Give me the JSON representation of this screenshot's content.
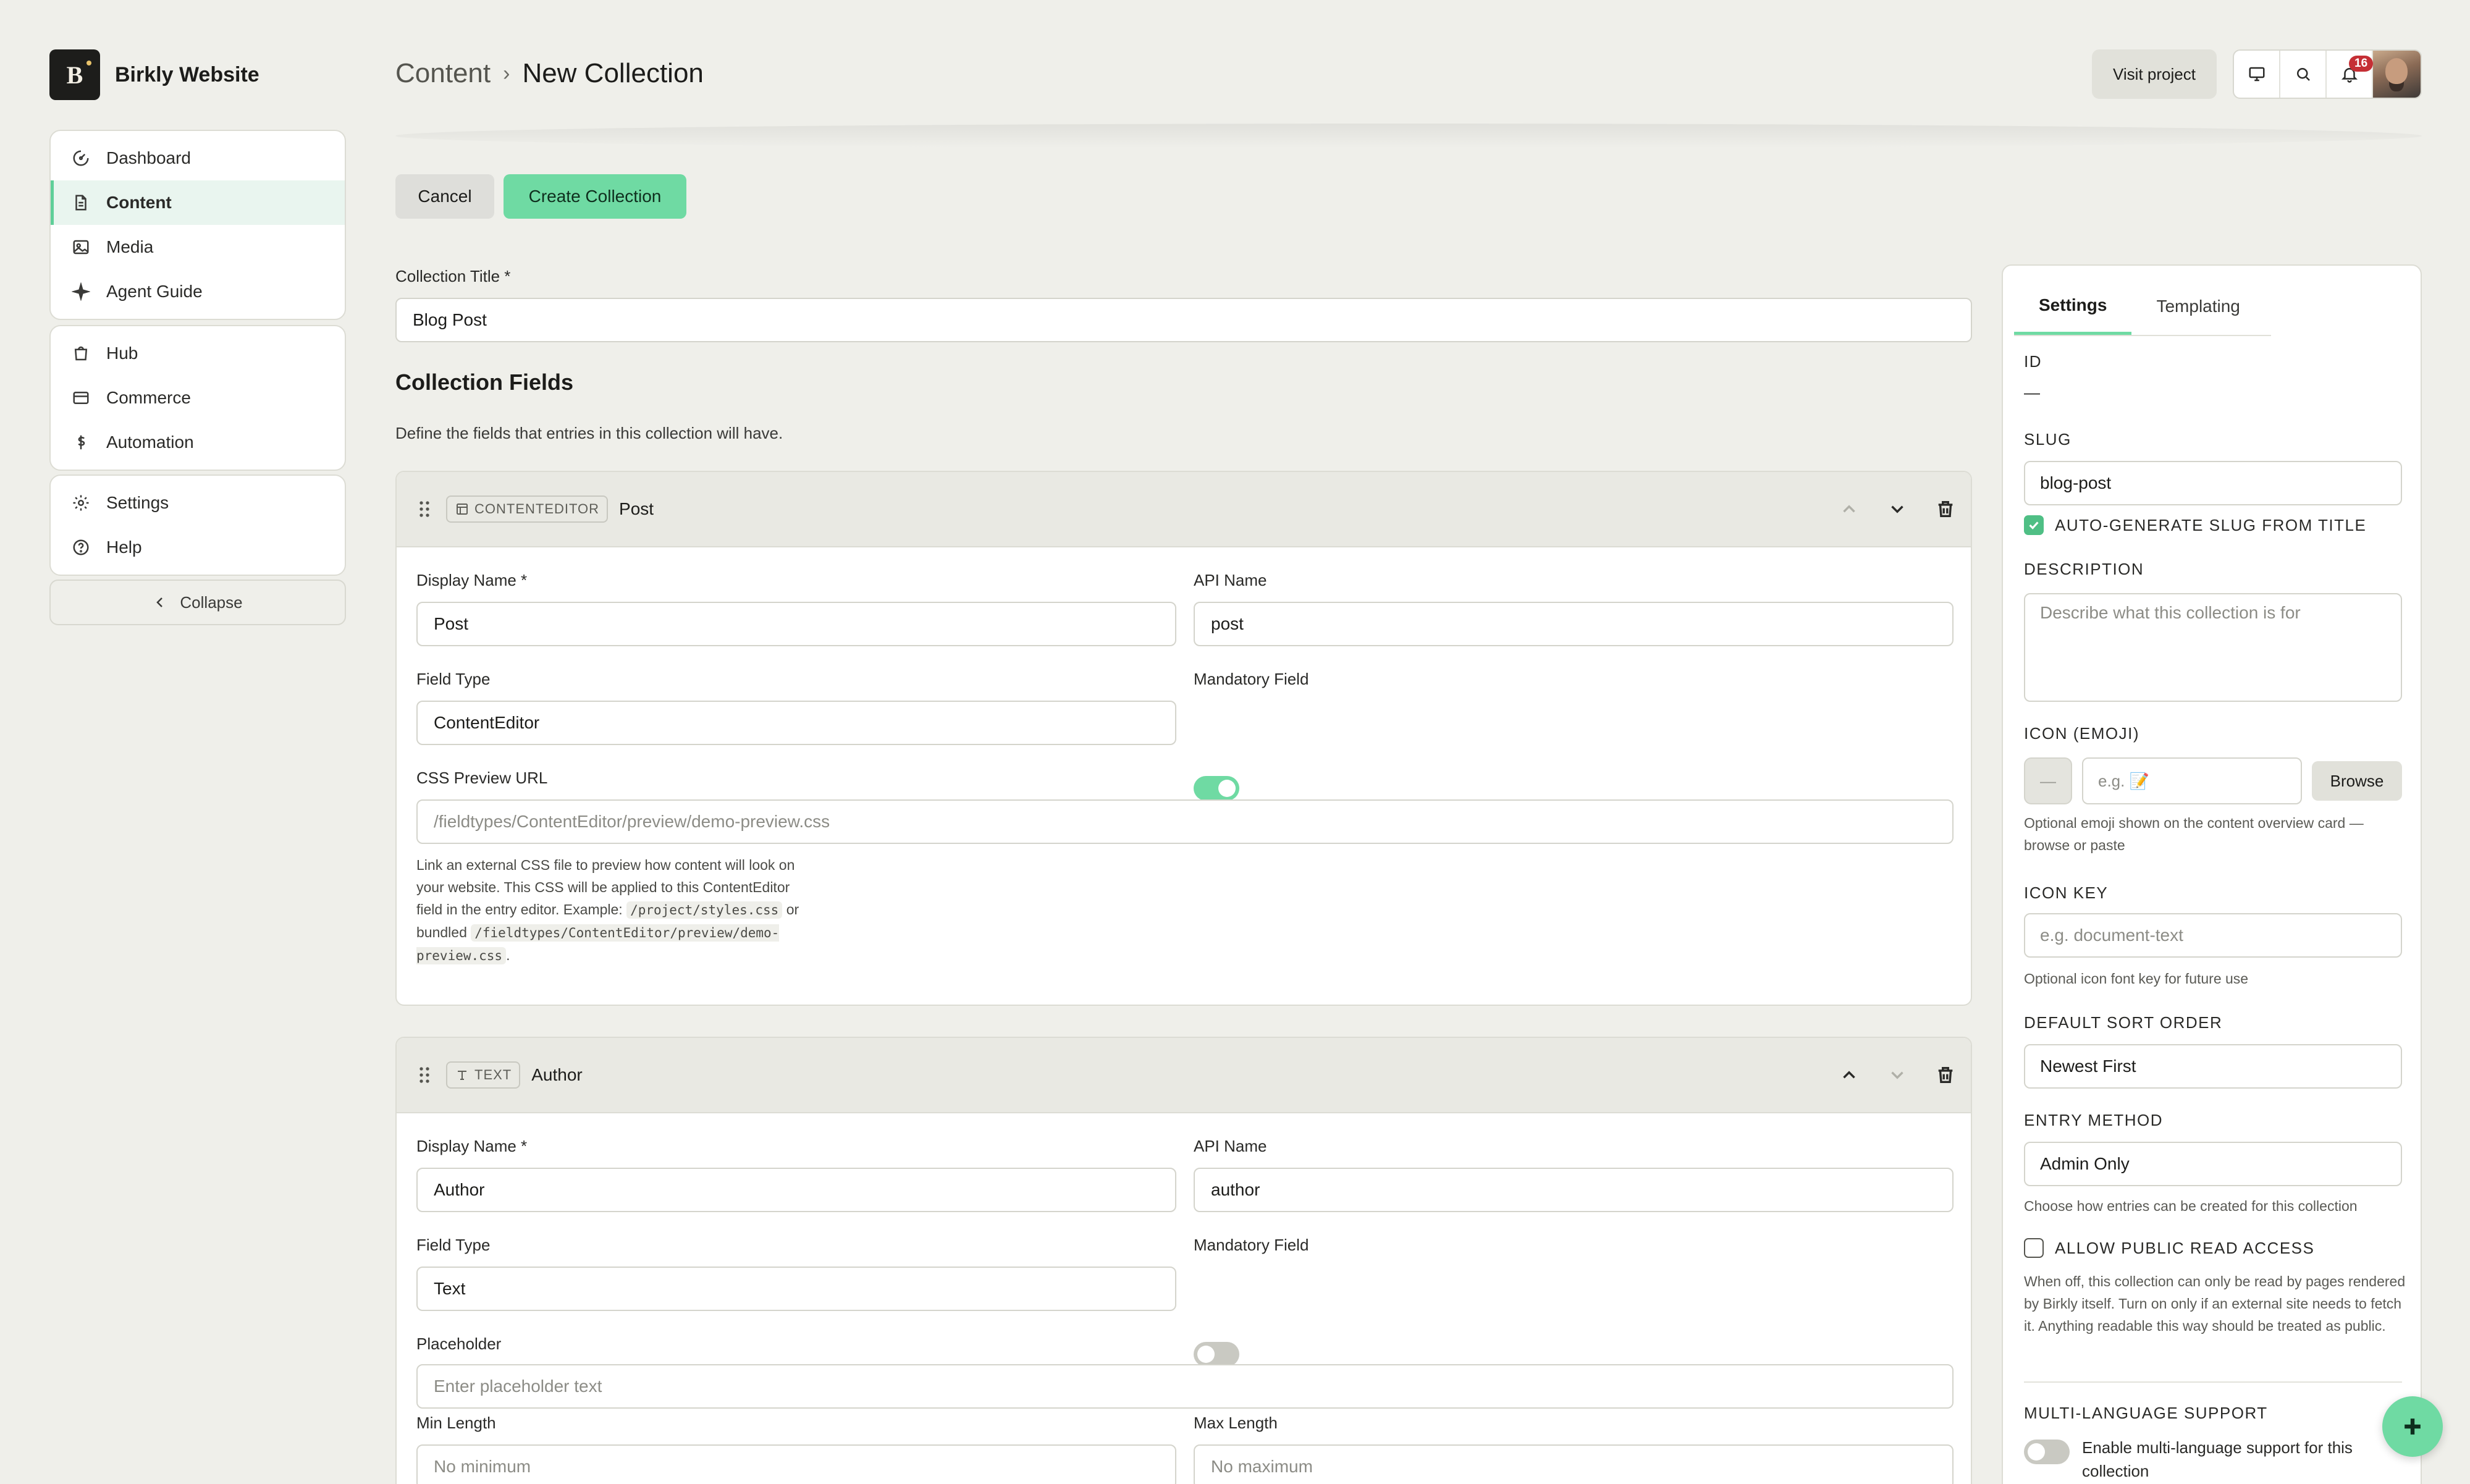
{
  "brand": {
    "logo": "B",
    "name": "Birkly Website"
  },
  "nav": {
    "group1": [
      {
        "label": "Dashboard",
        "icon": "dashboard-icon"
      },
      {
        "label": "Content",
        "icon": "document-icon",
        "active": true
      },
      {
        "label": "Media",
        "icon": "image-icon"
      },
      {
        "label": "Agent Guide",
        "icon": "sparkle-icon"
      }
    ],
    "group2": [
      {
        "label": "Hub",
        "icon": "bag-icon"
      },
      {
        "label": "Commerce",
        "icon": "card-icon"
      },
      {
        "label": "Automation",
        "icon": "dollar-icon"
      }
    ],
    "group3": [
      {
        "label": "Settings",
        "icon": "gear-icon"
      },
      {
        "label": "Help",
        "icon": "help-circle-icon"
      }
    ],
    "collapse_label": "Collapse"
  },
  "breadcrumb": {
    "root": "Content",
    "separator": "›",
    "current": "New Collection"
  },
  "header": {
    "visit_label": "Visit project",
    "notification_count": "16"
  },
  "actions": {
    "cancel": "Cancel",
    "create": "Create Collection"
  },
  "collection_title": {
    "label": "Collection Title *",
    "value": "Blog Post"
  },
  "fields_section": {
    "title": "Collection Fields",
    "description": "Define the fields that entries in this collection will have."
  },
  "fields": [
    {
      "type_chip": "CONTENTEDITOR",
      "name": "Post",
      "display_name_label": "Display Name *",
      "display_name": "Post",
      "api_name_label": "API Name",
      "api_name": "post",
      "field_type_label": "Field Type",
      "field_type": "ContentEditor",
      "mandatory_label": "Mandatory Field",
      "mandatory": true,
      "css_label": "CSS Preview URL",
      "css_placeholder": "/fieldtypes/ContentEditor/preview/demo-preview.css",
      "help_text_1": "Link an external CSS file to preview how content will look on your website. This CSS will be applied to this ContentEditor field in the entry editor. Example:",
      "help_code_1": "/project/styles.css",
      "help_text_2": "or bundled",
      "help_code_2": "/fieldtypes/ContentEditor/preview/demo-preview.css",
      "help_text_3": "."
    },
    {
      "type_chip": "TEXT",
      "name": "Author",
      "display_name_label": "Display Name *",
      "display_name": "Author",
      "api_name_label": "API Name",
      "api_name": "author",
      "field_type_label": "Field Type",
      "field_type": "Text",
      "mandatory_label": "Mandatory Field",
      "mandatory": false,
      "placeholder_label": "Placeholder",
      "placeholder_placeholder": "Enter placeholder text",
      "min_label": "Min Length",
      "min_placeholder": "No minimum",
      "max_label": "Max Length",
      "max_placeholder": "No maximum"
    }
  ],
  "settings_panel": {
    "tabs": [
      "Settings",
      "Templating"
    ],
    "id_label": "ID",
    "id_value": "—",
    "slug_label": "Slug",
    "slug_value": "blog-post",
    "auto_slug_label": "Auto-generate slug from title",
    "description_label": "Description",
    "description_placeholder": "Describe what this collection is for",
    "icon_label": "Icon (Emoji)",
    "icon_preview": "—",
    "icon_placeholder": "e.g. 📝",
    "browse_label": "Browse",
    "icon_help": "Optional emoji shown on the content overview card — browse or paste",
    "icon_key_label": "Icon Key",
    "icon_key_placeholder": "e.g. document-text",
    "icon_key_help": "Optional icon font key for future use",
    "sort_label": "Default Sort Order",
    "sort_value": "Newest First",
    "entry_label": "Entry Method",
    "entry_value": "Admin Only",
    "entry_help": "Choose how entries can be created for this collection",
    "public_read_label": "Allow public read access",
    "public_read_help": "When off, this collection can only be read by pages rendered by Birkly itself. Turn on only if an external site needs to fetch it. Anything readable this way should be treated as public.",
    "multilang_label": "Multi-language support",
    "multilang_toggle_label": "Enable multi-language support for this collection"
  },
  "colors": {
    "accent": "#6fdaa3",
    "badge": "#c52f35",
    "brand_bg": "#1d1d1b",
    "page_bg": "#efefea"
  }
}
